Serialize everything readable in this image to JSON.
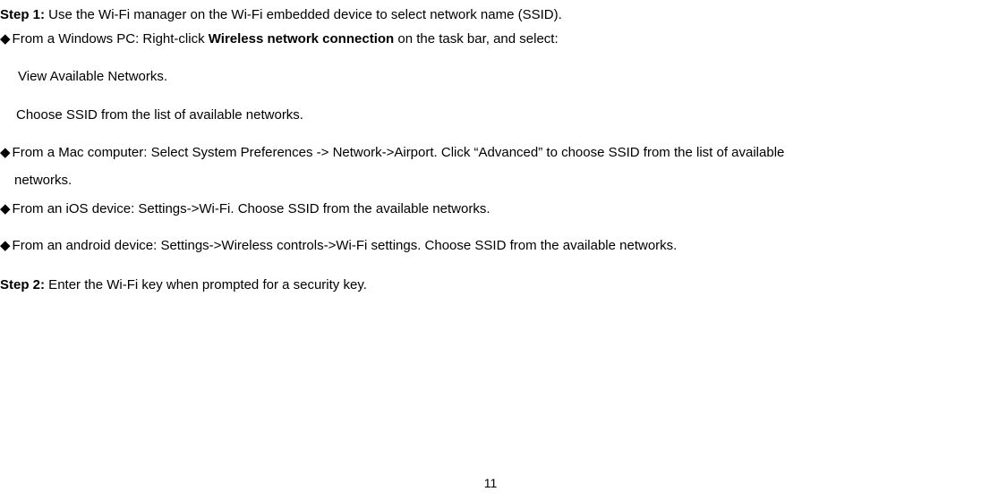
{
  "step1": {
    "label": "Step 1:",
    "text": " Use the Wi-Fi manager on the Wi-Fi embedded device to select network name (SSID)."
  },
  "windows": {
    "prefix": "From a Windows PC: Right-click ",
    "bold": "Wireless network connection",
    "suffix": " on the task bar, and select:",
    "sub1": "View Available Networks.",
    "sub2": "Choose SSID from the list of available networks."
  },
  "mac": {
    "line1": "From a Mac computer: Select System Preferences -> Network->Airport. Click “Advanced” to choose SSID from the list of available",
    "line2": "networks."
  },
  "ios": {
    "text": "From an iOS device: Settings->Wi-Fi. Choose SSID from the available networks."
  },
  "android": {
    "text": "From an android device: Settings->Wireless controls->Wi-Fi settings. Choose SSID from the available networks."
  },
  "step2": {
    "label": "Step 2:",
    "text": " Enter the Wi-Fi key when prompted for a security key."
  },
  "bullet": "◆",
  "page": "11"
}
